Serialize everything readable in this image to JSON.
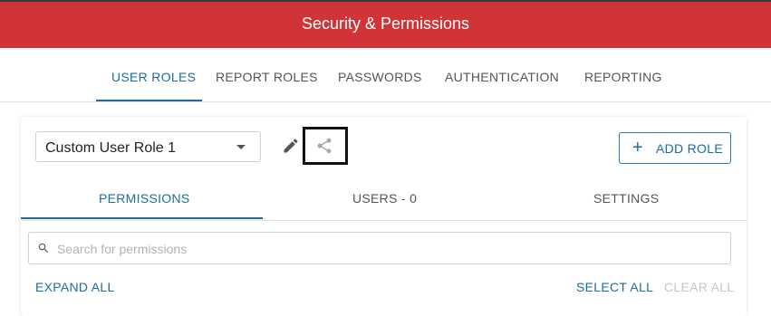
{
  "header": {
    "title": "Security & Permissions"
  },
  "tabs": [
    {
      "label": "USER ROLES",
      "active": true
    },
    {
      "label": "REPORT ROLES"
    },
    {
      "label": "PASSWORDS"
    },
    {
      "label": "AUTHENTICATION"
    },
    {
      "label": "REPORTING"
    }
  ],
  "role": {
    "selected": "Custom User Role 1",
    "add_label": "ADD ROLE"
  },
  "subtabs": [
    {
      "label": "PERMISSIONS",
      "active": true
    },
    {
      "label": "USERS - 0"
    },
    {
      "label": "SETTINGS"
    }
  ],
  "search": {
    "placeholder": "Search for permissions"
  },
  "actions": {
    "expand_all": "EXPAND ALL",
    "select_all": "SELECT ALL",
    "clear_all": "CLEAR ALL"
  },
  "icons": {
    "edit": "pencil-icon",
    "share": "share-icon",
    "add": "plus-icon",
    "search": "search-icon",
    "dropdown": "chevron-down-icon"
  },
  "colors": {
    "header": "#d03437",
    "accent": "#1b6e9b",
    "disabled": "#c6c6c6"
  }
}
